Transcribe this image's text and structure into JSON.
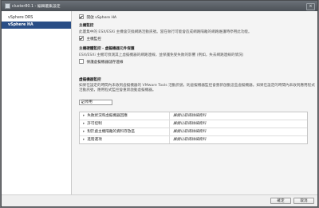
{
  "window": {
    "title": "cluster80.1 - 編輯叢集設定",
    "close_label": "×"
  },
  "sidebar": {
    "items": [
      {
        "label": "vSphere DRS"
      },
      {
        "label": "vSphere HA"
      }
    ]
  },
  "main": {
    "enable_ha": {
      "checked": true,
      "label": "開啟 vSphere HA"
    },
    "host_monitoring": {
      "heading": "主機監控",
      "description": "此叢集中的 ESX/ESXi 主機會交換網路活動訊號。當在執行可能會造成網路隔離的網路維護時停用此功能。",
      "checkbox_label": "主機監控",
      "checked": true
    },
    "admission_control": {
      "heading": "主機硬體監控 - 虛擬機器元件保護",
      "description": "ESX/ESXi 主機可偵測其上虛擬機器的網路連線，並保護免受失敗的影響 (例如，失去網路連線的情況)",
      "checkbox_label": "保護虛擬機器儲存連線",
      "checked": false
    },
    "vm_monitoring": {
      "heading": "虛擬機器監控",
      "description": "如果在設定的時間內未收到虛擬機器的 VMware Tools 活動訊號，則虛擬機器監控會重新啟動這些虛擬機器。如果在設定的時間內未收到應用程式活動訊號，應用程式監控會重新啟動虛擬機器。",
      "select_value": "已停用"
    },
    "settings_rows": [
      {
        "label": "失敗狀況和虛擬機器回應",
        "value": "展開以取得詳細資料"
      },
      {
        "label": "許可控制",
        "value": "展開以取得詳細資料"
      },
      {
        "label": "對於處主機隔離的資料存放區",
        "value": "展開以取得詳細資料"
      },
      {
        "label": "進階選項",
        "value": "展開以取得詳細資料"
      }
    ]
  },
  "footer": {
    "ok_label": "確定",
    "cancel_label": "取消"
  }
}
